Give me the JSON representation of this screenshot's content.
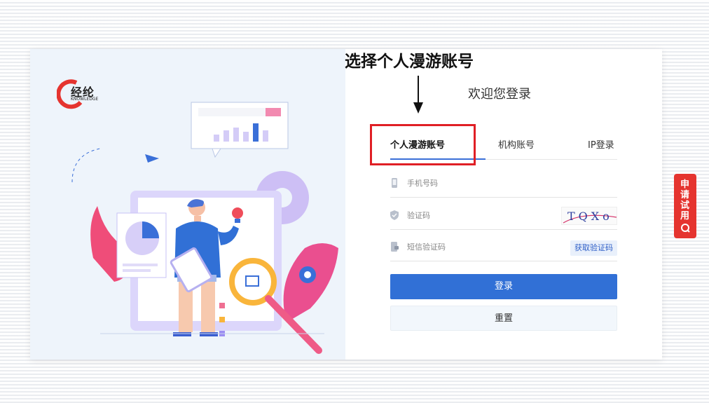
{
  "annotation": {
    "title": "选择个人漫游账号"
  },
  "brand": {
    "name": "经纶",
    "sub": "KNOWLEDGE"
  },
  "login": {
    "welcome": "欢迎您登录",
    "tabs": [
      {
        "label": "个人漫游账号",
        "active": true
      },
      {
        "label": "机构账号",
        "active": false
      },
      {
        "label": "IP登录",
        "active": false
      }
    ],
    "fields": {
      "phone_placeholder": "手机号码",
      "captcha_placeholder": "验证码",
      "captcha_text": "TQXo",
      "sms_placeholder": "短信验证码",
      "sms_button": "获取验证码"
    },
    "login_button": "登录",
    "reset_button": "重置"
  },
  "side": {
    "trial_label": "申请试用"
  },
  "colors": {
    "primary": "#3170d6",
    "highlight": "#e01f25",
    "brand_red": "#e5342f"
  },
  "icons": [
    "phone-icon",
    "shield-icon",
    "sms-icon",
    "trial-q-icon",
    "brand-logo-icon"
  ]
}
